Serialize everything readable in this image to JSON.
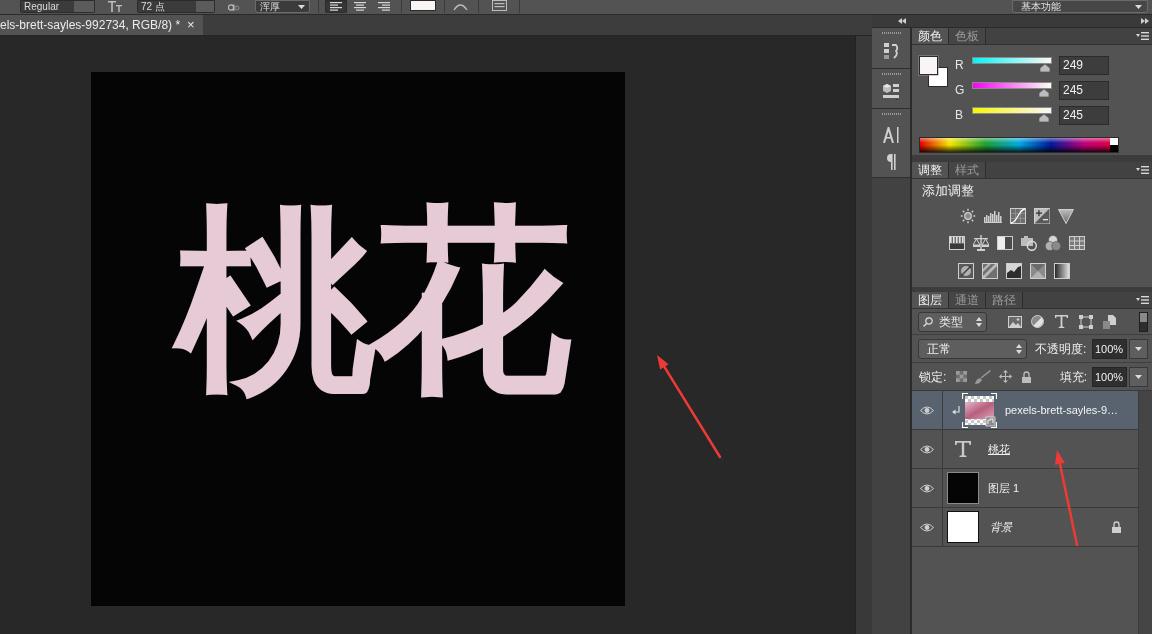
{
  "options_bar": {
    "font_style": "Regular",
    "font_size": "72 点",
    "anti_alias": "浑厚",
    "alignment": [
      {
        "kind": "left",
        "selected": true
      },
      {
        "kind": "center",
        "selected": false
      },
      {
        "kind": "right",
        "selected": false
      }
    ],
    "workspace": "基本功能"
  },
  "document_tab": {
    "title": "els-brett-sayles-992734, RGB/8) *",
    "close": "×"
  },
  "canvas": {
    "text": "桃花"
  },
  "color_panel": {
    "tabs": [
      {
        "label": "颜色",
        "selected": true
      },
      {
        "label": "色板",
        "selected": false
      }
    ],
    "channels": [
      {
        "label": "R",
        "level": 0.976,
        "value": "249"
      },
      {
        "label": "G",
        "level": 0.961,
        "value": "245"
      },
      {
        "label": "B",
        "level": 0.961,
        "value": "245"
      }
    ]
  },
  "adjustments_panel": {
    "tabs": [
      {
        "label": "调整",
        "selected": true
      },
      {
        "label": "样式",
        "selected": false
      }
    ],
    "heading": "添加调整"
  },
  "layers_panel": {
    "tabs": [
      {
        "label": "图层",
        "selected": true
      },
      {
        "label": "通道",
        "selected": false
      },
      {
        "label": "路径",
        "selected": false
      }
    ],
    "filter": "类型",
    "filter_on": false,
    "blend_mode": "正常",
    "opacity_label": "不透明度:",
    "opacity": "100%",
    "lock_label": "锁定:",
    "fill_label": "填充:",
    "fill": "100%",
    "layers": [
      {
        "kind": "smart",
        "name": "pexels-brett-sayles-9…",
        "visible": true,
        "selected": true,
        "clipped": true,
        "locked": false
      },
      {
        "kind": "text",
        "name": "桃花",
        "visible": true,
        "selected": false,
        "clipped": false,
        "locked": false
      },
      {
        "kind": "pixel",
        "name": "图层 1",
        "visible": true,
        "selected": false,
        "clipped": false,
        "locked": false
      },
      {
        "kind": "background",
        "name": "背景",
        "visible": true,
        "selected": false,
        "clipped": false,
        "locked": true
      }
    ]
  }
}
